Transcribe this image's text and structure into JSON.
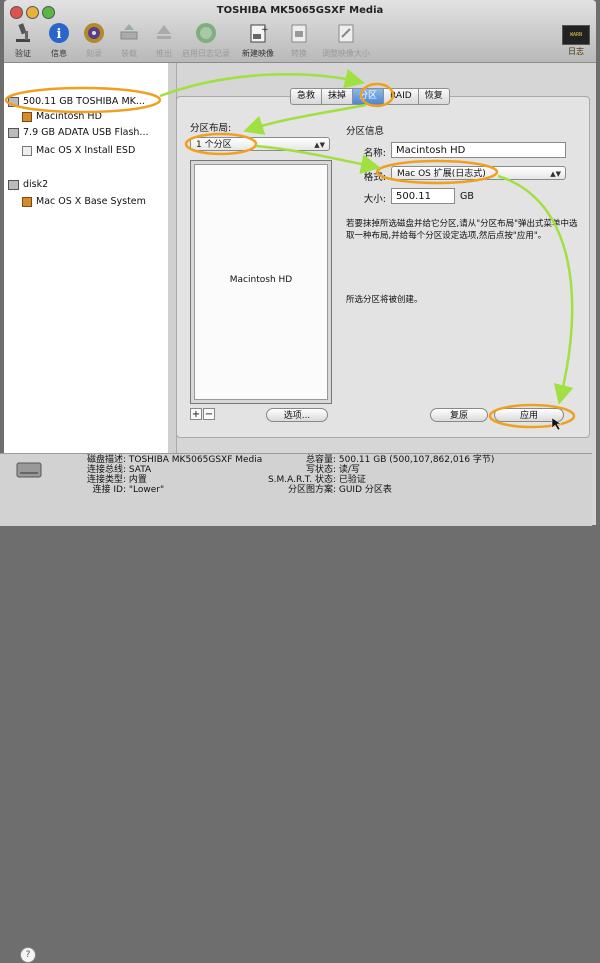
{
  "window": {
    "title": "TOSHIBA MK5065GSXF Media"
  },
  "toolbar": {
    "items": [
      {
        "label": "验证",
        "icon": "microscope-icon",
        "enabled": true
      },
      {
        "label": "信息",
        "icon": "info-icon",
        "enabled": true
      },
      {
        "label": "刻录",
        "icon": "burn-disc-icon",
        "enabled": false
      },
      {
        "label": "装载",
        "icon": "mount-icon",
        "enabled": false
      },
      {
        "label": "推出",
        "icon": "eject-icon",
        "enabled": false
      },
      {
        "label": "启用日志记录",
        "icon": "journaling-icon",
        "enabled": false
      },
      {
        "label": "新建映像",
        "icon": "new-image-icon",
        "enabled": true
      },
      {
        "label": "转换",
        "icon": "convert-icon",
        "enabled": false
      },
      {
        "label": "调整映像大小",
        "icon": "resize-image-icon",
        "enabled": false
      }
    ],
    "log_label": "日志",
    "log_badge": "WARN 9:20"
  },
  "sidebar": {
    "items": [
      {
        "label": "500.11 GB TOSHIBA MK...",
        "level": 0,
        "type": "disk",
        "selected": true
      },
      {
        "label": "Macintosh HD",
        "level": 1,
        "type": "volume"
      },
      {
        "label": "7.9 GB ADATA USB Flash...",
        "level": 0,
        "type": "disk"
      },
      {
        "label": "Mac OS X Install ESD",
        "level": 1,
        "type": "volume-white"
      },
      {
        "label": "disk2",
        "level": 0,
        "type": "disk"
      },
      {
        "label": "Mac OS X Base System",
        "level": 1,
        "type": "volume"
      }
    ]
  },
  "tabs": [
    {
      "label": "急救",
      "active": false
    },
    {
      "label": "抹掉",
      "active": false
    },
    {
      "label": "分区",
      "active": true
    },
    {
      "label": "RAID",
      "active": false
    },
    {
      "label": "恢复",
      "active": false
    }
  ],
  "partition": {
    "layout_title": "分区布局:",
    "layout_select": "1 个分区",
    "layout_part_name": "Macintosh HD",
    "info_title": "分区信息",
    "name_label": "名称:",
    "name_value": "Macintosh HD",
    "format_label": "格式:",
    "format_value": "Mac OS 扩展(日志式)",
    "size_label": "大小:",
    "size_value": "500.11",
    "size_unit": "GB",
    "description": "若要抹掉所选磁盘并给它分区,请从\"分区布局\"弹出式菜单中选取一种布局,并给每个分区设定选项,然后点按\"应用\"。",
    "status": "所选分区将被创建。",
    "add_label": "+",
    "remove_label": "−",
    "options_button": "选项...",
    "revert_button": "复原",
    "apply_button": "应用"
  },
  "info": {
    "left": [
      {
        "key": "磁盘描述:",
        "value": "TOSHIBA MK5065GSXF Media"
      },
      {
        "key": "连接总线:",
        "value": "SATA"
      },
      {
        "key": "连接类型:",
        "value": "内置"
      },
      {
        "key": "连接 ID:",
        "value": "\"Lower\""
      }
    ],
    "right": [
      {
        "key": "总容量:",
        "value": "500.11 GB (500,107,862,016 字节)"
      },
      {
        "key": "写状态:",
        "value": "读/写"
      },
      {
        "key": "S.M.A.R.T. 状态:",
        "value": "已验证"
      },
      {
        "key": "分区图方案:",
        "value": "GUID 分区表"
      }
    ]
  },
  "help_label": "?",
  "colors": {
    "annotation": "#f0a020",
    "arrow": "#a0e040",
    "tab_active": "#4b86d4"
  }
}
